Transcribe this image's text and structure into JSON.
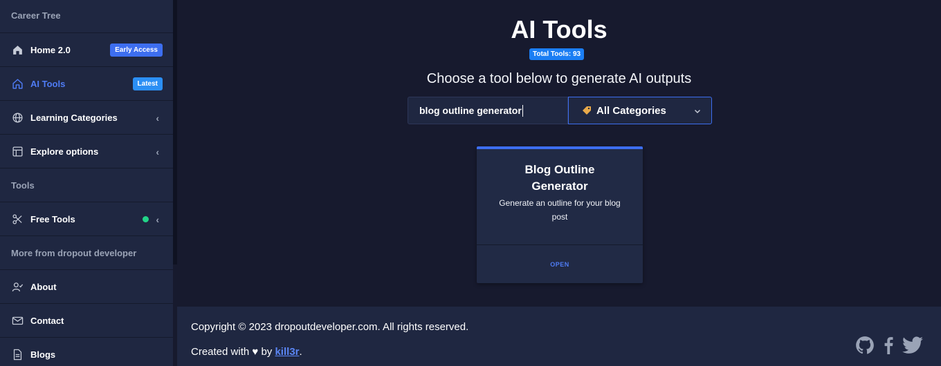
{
  "sidebar": {
    "items": [
      {
        "label": "Career Tree"
      },
      {
        "label": "Home 2.0",
        "badge": "Early Access",
        "icon": "home-icon"
      },
      {
        "label": "AI Tools",
        "badge": "Latest",
        "icon": "home-icon"
      },
      {
        "label": "Learning Categories",
        "icon": "globe-icon"
      },
      {
        "label": "Explore options",
        "icon": "layout-icon"
      },
      {
        "label": "Tools"
      },
      {
        "label": "Free Tools",
        "icon": "tools-icon"
      },
      {
        "label": "More from dropout developer"
      },
      {
        "label": "About",
        "icon": "user-check-icon"
      },
      {
        "label": "Contact",
        "icon": "mail-icon"
      },
      {
        "label": "Blogs",
        "icon": "file-icon"
      }
    ]
  },
  "main": {
    "title": "AI Tools",
    "total_badge": "Total Tools: 93",
    "subtitle": "Choose a tool below to generate AI outputs",
    "search": {
      "value": "blog outline generator"
    },
    "category_select": {
      "selected": "All Categories"
    },
    "card": {
      "title": "Blog Outline Generator",
      "description": "Generate an outline for your blog post",
      "action": "OPEN"
    }
  },
  "footer": {
    "copyright": "Copyright © 2023 dropoutdeveloper.com. All rights reserved.",
    "created_prefix": "Created with ♥ by ",
    "author": "kill3r",
    "created_suffix": ".",
    "socials": [
      "github-icon",
      "facebook-icon",
      "twitter-icon"
    ]
  },
  "colors": {
    "accent": "#3d6ef0",
    "background": "#171a2e",
    "panel": "#1f2741",
    "online_dot": "#22d488"
  }
}
